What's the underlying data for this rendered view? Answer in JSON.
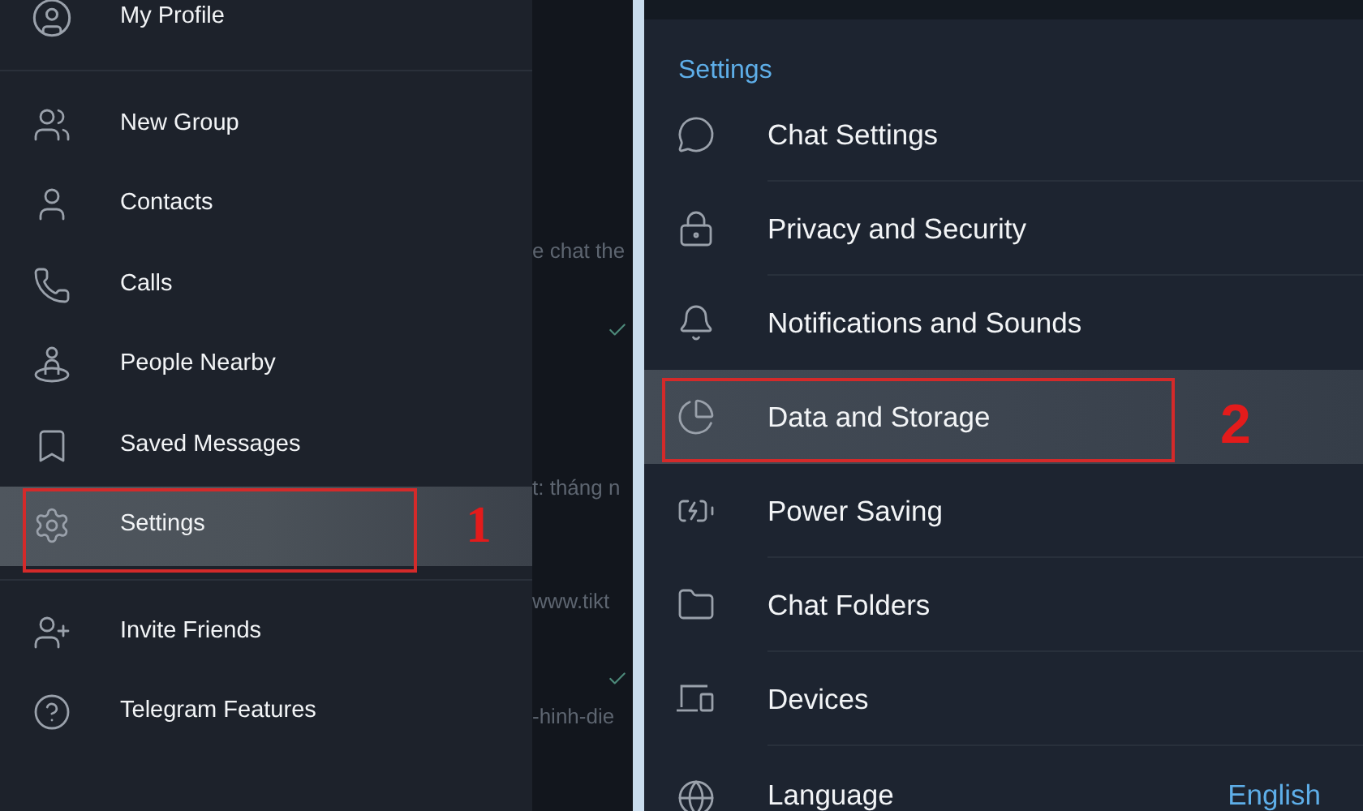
{
  "left_panel": {
    "profile": {
      "label": "My Profile"
    },
    "menu_items": [
      {
        "label": "New Group",
        "selected": false
      },
      {
        "label": "Contacts",
        "selected": false
      },
      {
        "label": "Calls",
        "selected": false
      },
      {
        "label": "People Nearby",
        "selected": false
      },
      {
        "label": "Saved Messages",
        "selected": false
      },
      {
        "label": "Settings",
        "selected": true
      }
    ],
    "extra_items": [
      {
        "label": "Invite Friends",
        "selected": false
      },
      {
        "label": "Telegram Features",
        "selected": false
      }
    ],
    "chat_fragments": [
      {
        "kind": "text",
        "text": "e chat the"
      },
      {
        "kind": "check"
      },
      {
        "kind": "text",
        "text": "t: tháng n"
      },
      {
        "kind": "text",
        "text": "www.tikt"
      },
      {
        "kind": "check"
      },
      {
        "kind": "text",
        "text": "-hinh-die"
      }
    ],
    "annotation": "1"
  },
  "right_panel": {
    "section_title": "Settings",
    "items": [
      {
        "label": "Chat Settings",
        "selected": false
      },
      {
        "label": "Privacy and Security",
        "selected": false
      },
      {
        "label": "Notifications and Sounds",
        "selected": false
      },
      {
        "label": "Data and Storage",
        "selected": true
      },
      {
        "label": "Power Saving",
        "selected": false
      },
      {
        "label": "Chat Folders",
        "selected": false
      },
      {
        "label": "Devices",
        "selected": false
      },
      {
        "label": "Language",
        "selected": false,
        "value": "English"
      }
    ],
    "annotation": "2"
  }
}
